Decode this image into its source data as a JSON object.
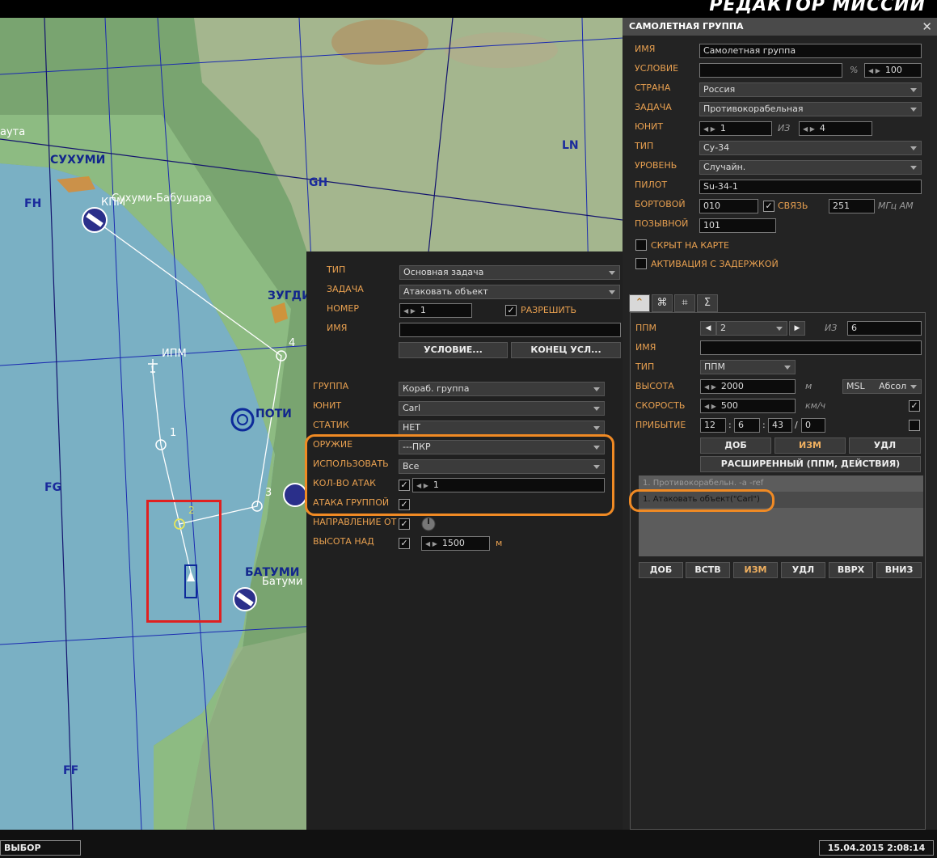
{
  "app": {
    "title": "РЕДАКТОР МИССИЙ"
  },
  "map": {
    "labels": {
      "sukhumi": "СУХУМИ",
      "sukhumi_airfield": "Сухуми-Бабушара",
      "knm": "КПМ",
      "ipm": "ИПМ",
      "zugdidi": "ЗУГДИ",
      "poti": "ПОТИ",
      "batumi": "БАТУМИ",
      "batumi_small": "Батуми",
      "left_edge": "аута",
      "grid_FH": "FH",
      "grid_GH": "GH",
      "grid_LN": "LN",
      "grid_FG": "FG",
      "grid_FF": "FF",
      "wp1": "1",
      "wp2": "2",
      "wp3": "3",
      "wp4": "4"
    }
  },
  "task_panel": {
    "type_label": "ТИП",
    "type_value": "Основная задача",
    "task_label": "ЗАДАЧА",
    "task_value": "Атаковать объект",
    "number_label": "НОМЕР",
    "number_value": "1",
    "allow_label": "РАЗРЕШИТЬ",
    "allow_checked": "✓",
    "name_label": "ИМЯ",
    "name_value": "",
    "condition_button": "УСЛОВИЕ...",
    "end_condition_button": "КОНЕЦ УСЛ...",
    "group_label": "ГРУППА",
    "group_value": "Кораб. группа",
    "unit_label": "ЮНИТ",
    "unit_value": "Carl",
    "static_label": "СТАТИК",
    "static_value": "НЕТ",
    "weapon_label": "ОРУЖИЕ",
    "weapon_value": "---ПКР",
    "use_label": "ИСПОЛЬЗОВАТЬ",
    "use_value": "Все",
    "attack_count_label": "КОЛ-ВО АТАК",
    "attack_count_value": "1",
    "attack_count_checked": "✓",
    "group_attack_label": "АТАКА ГРУППОЙ",
    "group_attack_checked": "✓",
    "direction_label": "НАПРАВЛЕНИЕ ОТ",
    "direction_checked": "✓",
    "altitude_label": "ВЫСОТА НАД",
    "altitude_checked": "✓",
    "altitude_value": "1500",
    "altitude_unit": "м"
  },
  "right_panel": {
    "header": "САМОЛЕТНАЯ ГРУППА",
    "close": "✕",
    "name_label": "ИМЯ",
    "name_value": "Самолетная группа",
    "condition_label": "УСЛОВИЕ",
    "condition_value": "",
    "percent_sign": "%",
    "percent_value": "100",
    "country_label": "СТРАНА",
    "country_value": "Россия",
    "task_label": "ЗАДАЧА",
    "task_value": "Противокорабельная",
    "unit_label": "ЮНИТ",
    "unit_value": "1",
    "of_label": "ИЗ",
    "unit_total": "4",
    "type_label": "ТИП",
    "type_value": "Су-34",
    "skill_label": "УРОВЕНЬ",
    "skill_value": "Случайн.",
    "pilot_label": "ПИЛОТ",
    "pilot_value": "Su-34-1",
    "board_label": "БОРТОВОЙ",
    "board_value": "010",
    "comm_checked": "✓",
    "comm_label": "СВЯЗЬ",
    "freq_value": "251",
    "freq_unit": "МГц АМ",
    "callsign_label": "ПОЗЫВНОЙ",
    "callsign_value": "101",
    "hidden_label": "СКРЫТ НА КАРТЕ",
    "late_activation_label": "АКТИВАЦИЯ С ЗАДЕРЖКОЙ",
    "tabs": [
      "⌃",
      "⌘",
      "⌗",
      "Σ"
    ],
    "wp": {
      "ppm_label": "ППМ",
      "ppm_value": "2",
      "of_label": "ИЗ",
      "ppm_total": "6",
      "name_label": "ИМЯ",
      "name_value": "",
      "type_label": "ТИП",
      "type_value": "ППМ",
      "alt_label": "ВЫСОТА",
      "alt_value": "2000",
      "alt_unit": "м",
      "alt_ref": "MSL",
      "alt_mode": "Абсол",
      "speed_label": "СКОРОСТЬ",
      "speed_value": "500",
      "speed_unit": "км/ч",
      "speed_checked": "✓",
      "arrival_label": "ПРИБЫТИЕ",
      "arr_h": "12",
      "arr_m": "6",
      "arr_s": "43",
      "arr_d": "0",
      "sep_colon": ":",
      "sep_slash": "/",
      "add_button": "ДОБ",
      "edit_button": "ИЗМ",
      "delete_button": "УДЛ",
      "advanced_button": "РАСШИРЕННЫЙ (ППМ, ДЕЙСТВИЯ)",
      "actions": [
        "1. Противокорабельн. -а -ref",
        "1. Атаковать объект(\"Carl\")"
      ],
      "list_buttons": [
        "ДОБ",
        "ВСТВ",
        "ИЗМ",
        "УДЛ",
        "ВВРХ",
        "ВНИЗ"
      ]
    }
  },
  "bottom": {
    "mode": "ВЫБОР",
    "datetime": "15.04.2015 2:08:14"
  }
}
